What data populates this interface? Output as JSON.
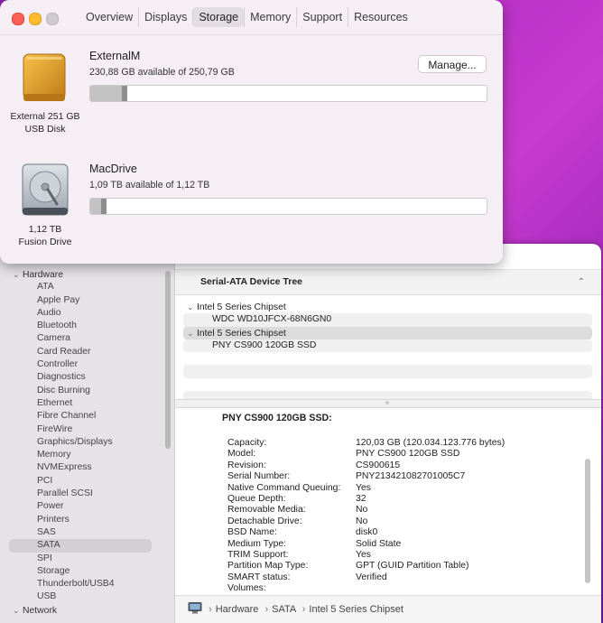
{
  "about_window": {
    "tabs": [
      "Overview",
      "Displays",
      "Storage",
      "Memory",
      "Support",
      "Resources"
    ],
    "active_tab": "Storage",
    "volumes": [
      {
        "name": "ExternalM",
        "available": "230,88 GB available of 250,79 GB",
        "caption_line1": "External 251 GB",
        "caption_line2": "USB Disk",
        "used_fraction": 0.08,
        "icon": "external-usb-disk-icon"
      },
      {
        "name": "MacDrive",
        "available": "1,09 TB available of 1,12 TB",
        "caption_line1": "1,12 TB",
        "caption_line2": "Fusion Drive",
        "used_fraction": 0.027,
        "icon": "hard-drive-icon"
      }
    ],
    "manage_label": "Manage..."
  },
  "system_info": {
    "sidebar": {
      "hardware_label": "Hardware",
      "hardware_items": [
        "ATA",
        "Apple Pay",
        "Audio",
        "Bluetooth",
        "Camera",
        "Card Reader",
        "Controller",
        "Diagnostics",
        "Disc Burning",
        "Ethernet",
        "Fibre Channel",
        "FireWire",
        "Graphics/Displays",
        "Memory",
        "NVMExpress",
        "PCI",
        "Parallel SCSI",
        "Power",
        "Printers",
        "SAS",
        "SATA",
        "SPI",
        "Storage",
        "Thunderbolt/USB4",
        "USB"
      ],
      "selected": "SATA",
      "network_label": "Network"
    },
    "tree": {
      "header": "Serial-ATA Device Tree",
      "rows": [
        {
          "label": "Intel 5 Series Chipset",
          "level": 0
        },
        {
          "label": "WDC WD10JFCX-68N6GN0",
          "level": 1
        },
        {
          "label": "Intel 5 Series Chipset",
          "level": 0,
          "selected": true
        },
        {
          "label": "PNY CS900 120GB SSD",
          "level": 1
        }
      ]
    },
    "detail": {
      "title": "PNY CS900 120GB SSD:",
      "fields": [
        {
          "k": "Capacity:",
          "v": "120,03 GB (120.034.123.776 bytes)"
        },
        {
          "k": "Model:",
          "v": "PNY CS900 120GB SSD"
        },
        {
          "k": "Revision:",
          "v": "CS900615"
        },
        {
          "k": "Serial Number:",
          "v": "PNY213421082701005C7"
        },
        {
          "k": "Native Command Queuing:",
          "v": "Yes"
        },
        {
          "k": "Queue Depth:",
          "v": "32"
        },
        {
          "k": "Removable Media:",
          "v": "No"
        },
        {
          "k": "Detachable Drive:",
          "v": "No"
        },
        {
          "k": "BSD Name:",
          "v": "disk0"
        },
        {
          "k": "Medium Type:",
          "v": "Solid State"
        },
        {
          "k": "TRIM Support:",
          "v": "Yes"
        },
        {
          "k": "Partition Map Type:",
          "v": "GPT (GUID Partition Table)"
        },
        {
          "k": "SMART status:",
          "v": "Verified"
        },
        {
          "k": "Volumes:",
          "v": ""
        }
      ]
    },
    "path": [
      "Hardware",
      "SATA",
      "Intel 5 Series Chipset"
    ]
  },
  "colors": {
    "close": "#ff5f57",
    "minimize": "#febc2e",
    "zoom_inactive": "#cfcacf",
    "external_disk": "#e0a030"
  }
}
